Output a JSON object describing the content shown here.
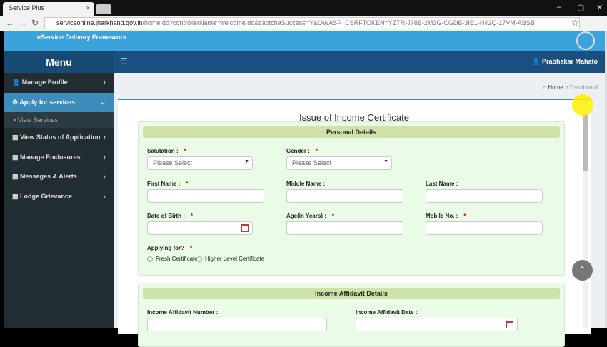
{
  "browser": {
    "tab_title": "Service Plus",
    "url_host": "serviceonline.jharkhand.gov.in",
    "url_path": "/home.do?controllerName=welcome.do&captchaSuccess=Y&OWASP_CSRFTOKEN=YZTR-J78B-2M3G-CGDB-3IE1-H42Q-17VM-ABSB"
  },
  "banner": {
    "subtitle": "eService Delivery Framework"
  },
  "header": {
    "menu": "Menu",
    "user": "Prabhakar Mahato"
  },
  "sidebar": {
    "items": [
      {
        "label": "Manage Profile"
      },
      {
        "label": "Apply for services"
      },
      {
        "label": "View Services"
      },
      {
        "label": "View Status of Application"
      },
      {
        "label": "Manage Enclosures"
      },
      {
        "label": "Messages & Alerts"
      },
      {
        "label": "Lodge Grievance"
      }
    ]
  },
  "breadcrumb": {
    "home": "Home",
    "sep": ">",
    "current": "Dashboard"
  },
  "form": {
    "title": "Issue of Income Certificate",
    "personal": {
      "heading": "Personal Details",
      "salutation": "Salutation :",
      "gender": "Gender :",
      "select_placeholder": "Please Select",
      "first_name": "First Name :",
      "middle_name": "Middle Name :",
      "last_name": "Last Name :",
      "dob": "Date of Birth :",
      "age": "Age(in Years) :",
      "mobile": "Mobile No. :",
      "applying_for": "Applying for?",
      "opt_fresh": "Fresh Certificate",
      "opt_higher": "Higher Level Certificate",
      "required": "*"
    },
    "affidavit": {
      "heading": "Income Affidavit Details",
      "number": "Income Affidavit Number :",
      "date": "Income Affidavit Date :"
    }
  }
}
